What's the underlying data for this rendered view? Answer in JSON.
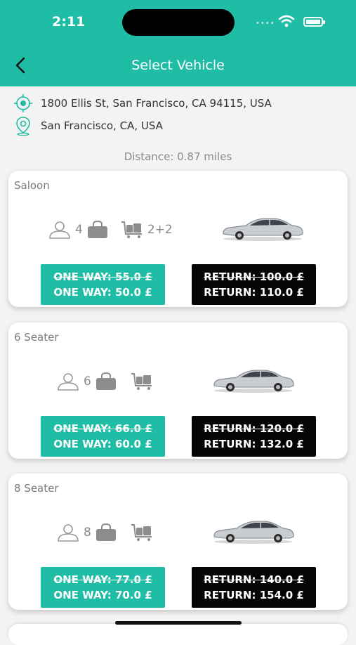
{
  "status_bar": {
    "time": "2:11"
  },
  "header": {
    "title": "Select Vehicle"
  },
  "route": {
    "pickup": "1800 Ellis St, San Francisco, CA 94115, USA",
    "dropoff": "San Francisco, CA, USA",
    "distance": "Distance: 0.87 miles"
  },
  "vehicles": [
    {
      "name": "Saloon",
      "passengers": "4",
      "luggage": "2+2",
      "one_way_old": "ONE WAY: 55.0 £",
      "one_way_new": "ONE WAY: 50.0 £",
      "return_old": "RETURN: 100.0 £",
      "return_new": "RETURN: 110.0 £"
    },
    {
      "name": "6 Seater",
      "passengers": "6",
      "luggage": "",
      "one_way_old": "ONE WAY: 66.0 £",
      "one_way_new": "ONE WAY: 60.0 £",
      "return_old": "RETURN: 120.0 £",
      "return_new": "RETURN: 132.0 £"
    },
    {
      "name": "8 Seater",
      "passengers": "8",
      "luggage": "",
      "one_way_old": "ONE WAY: 77.0 £",
      "one_way_new": "ONE WAY: 70.0 £",
      "return_old": "RETURN: 140.0 £",
      "return_new": "RETURN: 154.0 £"
    }
  ],
  "colors": {
    "accent": "#1fbca6",
    "return_button": "#050505"
  },
  "icons": [
    "back-arrow-icon",
    "pickup-target-icon",
    "location-pin-icon",
    "passenger-icon",
    "bag-icon",
    "luggage-trolley-icon",
    "car-image",
    "wifi-icon",
    "battery-icon"
  ]
}
